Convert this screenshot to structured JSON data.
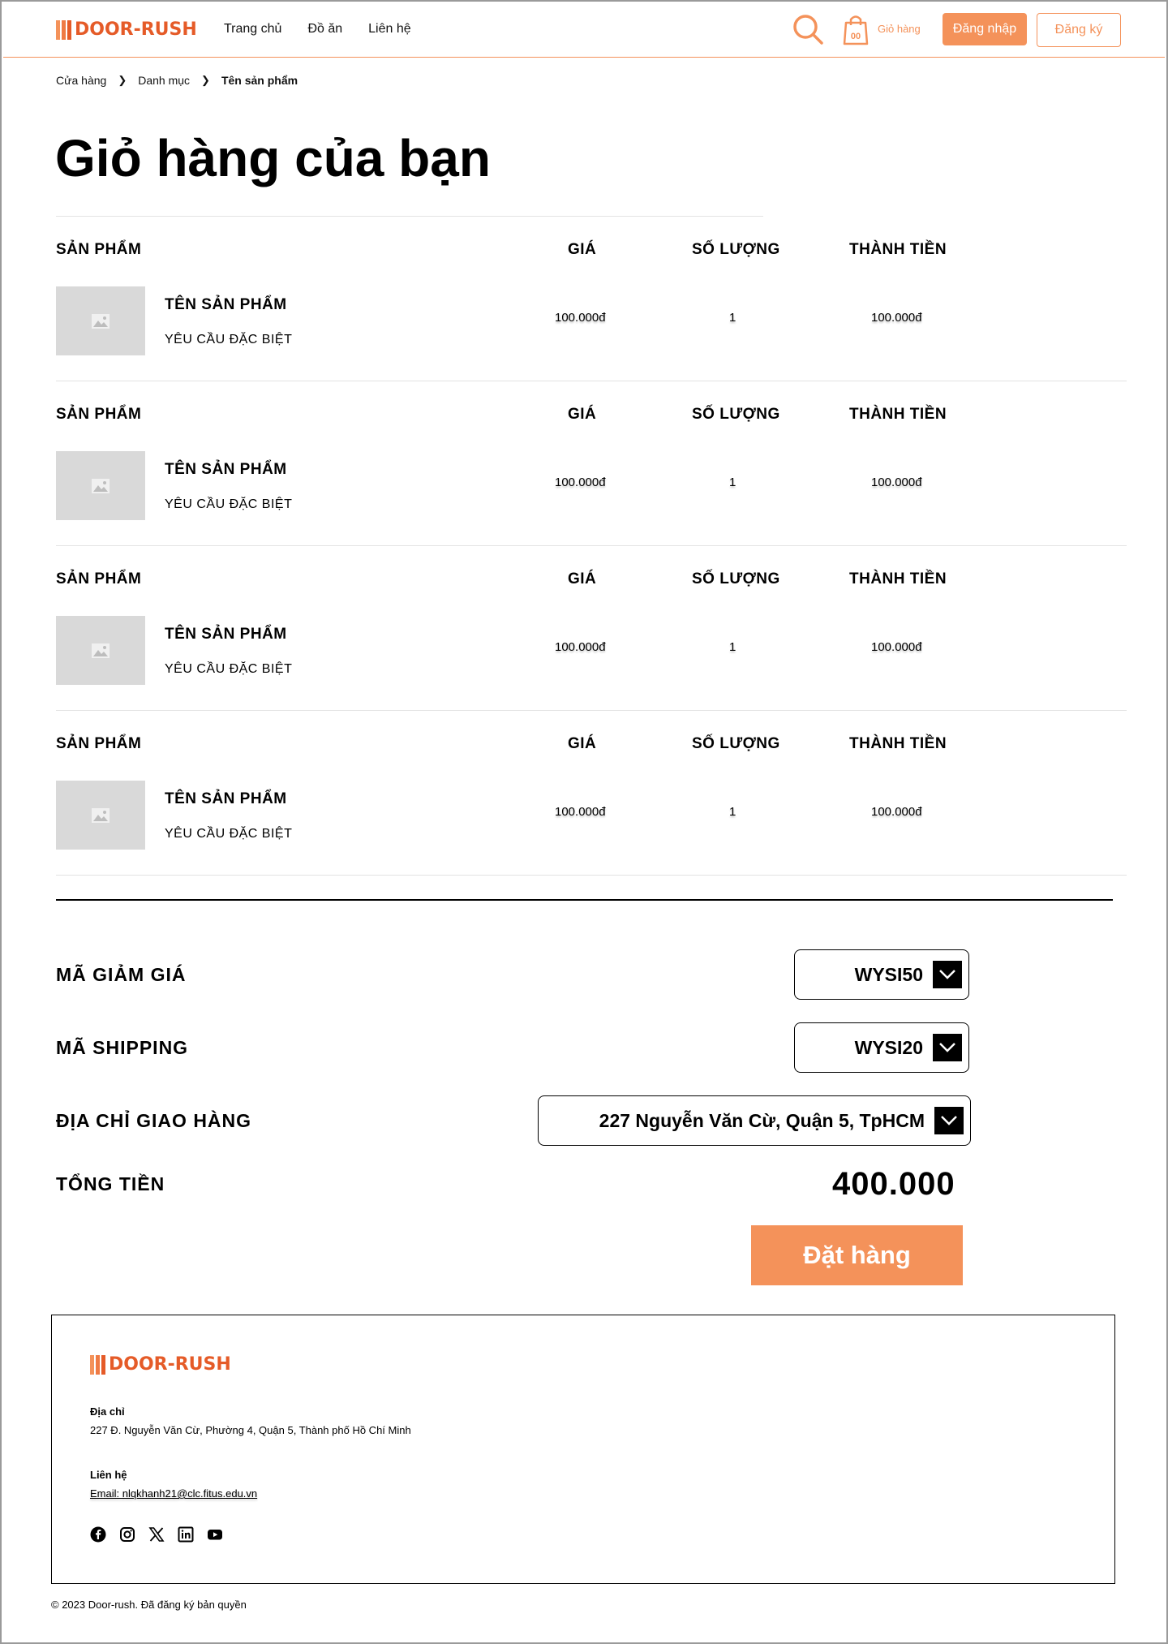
{
  "brand": {
    "name": "DOOR-RUSH",
    "colors": {
      "primary": "#f4925a",
      "logo": "#e55b28",
      "bars": [
        "#f4925a",
        "#ef7a44",
        "#e55b28"
      ]
    }
  },
  "header": {
    "nav": [
      "Trang chủ",
      "Đồ ăn",
      "Liên hệ"
    ],
    "cart_count": "00",
    "cart_label": "Giỏ hàng",
    "login_label": "Đăng nhập",
    "register_label": "Đăng ký"
  },
  "breadcrumb": [
    "Cửa hàng",
    "Danh mục",
    "Tên sản phẩm"
  ],
  "page_title": "Giỏ hàng của bạn",
  "cart": {
    "headers": {
      "product": "SẢN PHẨM",
      "price": "GIÁ",
      "quantity": "SỐ LƯỢNG",
      "total": "THÀNH TIỀN"
    },
    "items": [
      {
        "name": "TÊN SẢN PHẨM",
        "note": "YÊU CẦU ĐẶC BIỆT",
        "price": "100.000đ",
        "quantity": "1",
        "total": "100.000đ"
      },
      {
        "name": "TÊN SẢN PHẨM",
        "note": "YÊU CẦU ĐẶC BIỆT",
        "price": "100.000đ",
        "quantity": "1",
        "total": "100.000đ"
      },
      {
        "name": "TÊN SẢN PHẨM",
        "note": "YÊU CẦU ĐẶC BIỆT",
        "price": "100.000đ",
        "quantity": "1",
        "total": "100.000đ"
      },
      {
        "name": "TÊN SẢN PHẨM",
        "note": "YÊU CẦU ĐẶC BIỆT",
        "price": "100.000đ",
        "quantity": "1",
        "total": "100.000đ"
      }
    ]
  },
  "summary": {
    "discount_label": "MÃ GIẢM GIÁ",
    "discount_value": "WYSI50",
    "shipping_label": "MÃ SHIPPING",
    "shipping_value": "WYSI20",
    "address_label": "ĐỊA CHỈ GIAO HÀNG",
    "address_value": "227 Nguyễn Văn Cừ, Quận 5, TpHCM",
    "total_label": "TỔNG TIỀN",
    "total_value": "400.000",
    "order_button": "Đặt hàng"
  },
  "footer": {
    "address_label": "Địa chỉ",
    "address_text": "227 Đ. Nguyễn Văn Cừ, Phường 4, Quận 5, Thành phố Hồ Chí Minh",
    "contact_label": "Liên hệ",
    "email_text": "Email: nlqkhanh21@clc.fitus.edu.vn",
    "socials": [
      "facebook-icon",
      "instagram-icon",
      "x-icon",
      "linkedin-icon",
      "youtube-icon"
    ],
    "copyright": "© 2023 Door-rush. Đã đăng ký bản quyền"
  }
}
